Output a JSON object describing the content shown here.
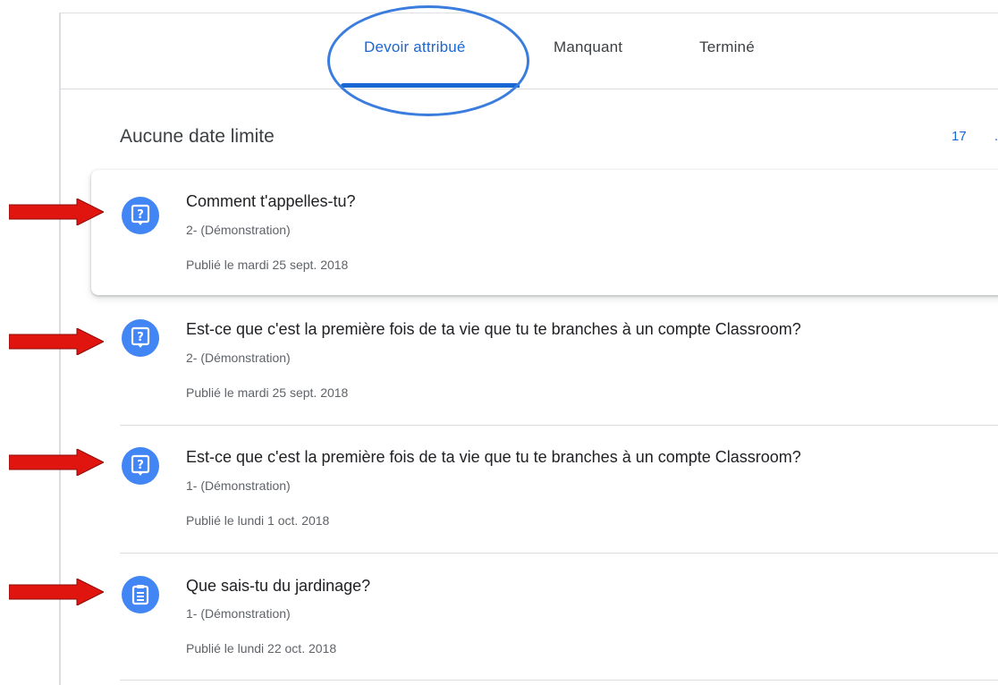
{
  "tabs": [
    {
      "label": "Devoir attribué",
      "active": true
    },
    {
      "label": "Manquant",
      "active": false
    },
    {
      "label": "Terminé",
      "active": false
    }
  ],
  "section": {
    "title": "Aucune date limite",
    "count": "17",
    "count_cut": "."
  },
  "items": [
    {
      "title": "Comment t'appelles-tu?",
      "class": "2- (Démonstration)",
      "date": "Publié le mardi 25 sept. 2018",
      "icon": "question-icon"
    },
    {
      "title": "Est-ce que c'est la première fois de ta vie que tu te branches à un compte Classroom?",
      "class": "2- (Démonstration)",
      "date": "Publié le mardi 25 sept. 2018",
      "icon": "question-icon"
    },
    {
      "title": "Est-ce que c'est la première fois de ta vie que tu te branches à un compte Classroom?",
      "class": "1- (Démonstration)",
      "date": "Publié le lundi 1 oct. 2018",
      "icon": "question-icon"
    },
    {
      "title": "Que sais-tu du jardinage?",
      "class": "1- (Démonstration)",
      "date": "Publié le lundi 22 oct. 2018",
      "icon": "assignment-icon"
    }
  ],
  "colors": {
    "accent": "#1967d2",
    "icon_bg": "#4285f4",
    "annotation_arrow": "#e0150f",
    "annotation_circle": "#3b7ddd"
  }
}
